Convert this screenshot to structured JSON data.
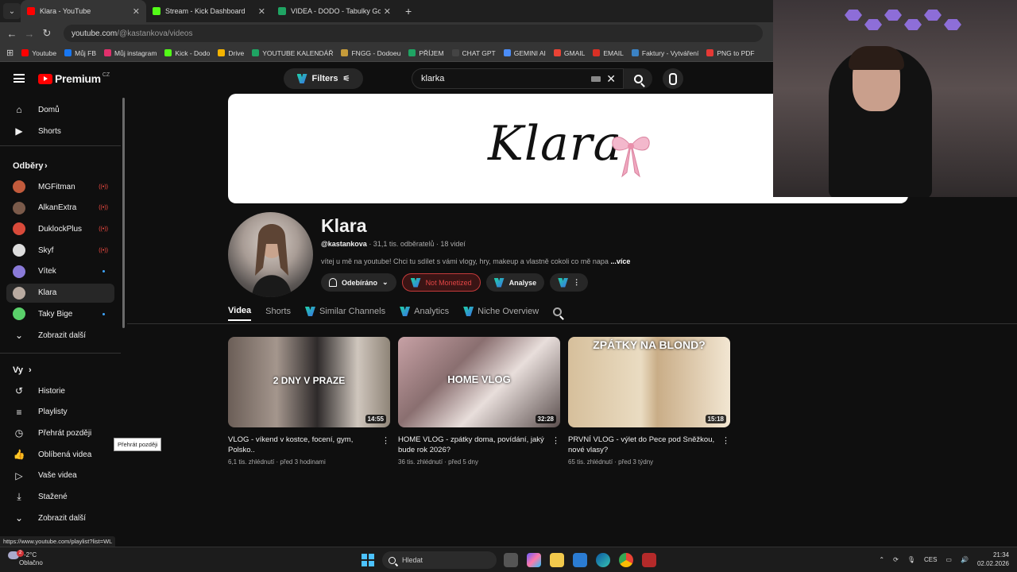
{
  "browser": {
    "tabs": [
      {
        "label": "Klara - YouTube",
        "color": "#ff0000",
        "active": true
      },
      {
        "label": "Stream - Kick Dashboard",
        "color": "#53fc18",
        "active": false
      },
      {
        "label": "VIDEA - DODO - Tabulky Goog",
        "color": "#1fa463",
        "active": false
      }
    ],
    "url_host": "youtube.com",
    "url_path": "/@kastankova/videos",
    "bookmarks": [
      {
        "label": "Youtube",
        "color": "#ff0000"
      },
      {
        "label": "Můj FB",
        "color": "#1877f2"
      },
      {
        "label": "Můj instagram",
        "color": "#e1306c"
      },
      {
        "label": "Kick - Dodo",
        "color": "#53fc18"
      },
      {
        "label": "Drive",
        "color": "#f4b400"
      },
      {
        "label": "YOUTUBE KALENDÁŘ",
        "color": "#1fa463"
      },
      {
        "label": "FNGG - Dodoeu",
        "color": "#c59b3a"
      },
      {
        "label": "PŘÍJEM",
        "color": "#1fa463"
      },
      {
        "label": "CHAT GPT",
        "color": "#444444"
      },
      {
        "label": "GEMINI AI",
        "color": "#4b8df8"
      },
      {
        "label": "GMAIL",
        "color": "#ea4335"
      },
      {
        "label": "EMAIL",
        "color": "#d93025"
      },
      {
        "label": "Faktury - Vytváření",
        "color": "#3b82c4"
      },
      {
        "label": "PNG to PDF",
        "color": "#e53935"
      }
    ]
  },
  "header": {
    "logo_text": "Premium",
    "logo_country": "CZ",
    "filters_label": "Filters",
    "search_value": "klarka"
  },
  "sidebar": {
    "main": [
      {
        "label": "Domů",
        "icon": "home-icon"
      },
      {
        "label": "Shorts",
        "icon": "shorts-icon"
      }
    ],
    "subs_heading": "Odběry",
    "subscriptions": [
      {
        "label": "MGFitman",
        "color": "#c25b3c",
        "live": true
      },
      {
        "label": "AlkanExtra",
        "color": "#7a5a4a",
        "live": true
      },
      {
        "label": "DuklockPlus",
        "color": "#d84a3a",
        "live": true
      },
      {
        "label": "Skyf",
        "color": "#dddddd",
        "live": true
      },
      {
        "label": "Vítek",
        "color": "#8a7ad8",
        "live": false,
        "dot": true
      },
      {
        "label": "Klara",
        "color": "#b8aaa0",
        "live": false,
        "selected": true
      },
      {
        "label": "Taky Bige",
        "color": "#5ad06a",
        "live": false,
        "dot": true
      }
    ],
    "show_more_1": "Zobrazit další",
    "you_heading": "Vy",
    "you_items": [
      {
        "label": "Historie",
        "icon": "history-icon"
      },
      {
        "label": "Playlisty",
        "icon": "playlists-icon"
      },
      {
        "label": "Přehrát později",
        "icon": "watch-later-icon"
      },
      {
        "label": "Oblíbená videa",
        "icon": "liked-icon"
      },
      {
        "label": "Vaše videa",
        "icon": "your-videos-icon"
      },
      {
        "label": "Stažené",
        "icon": "download-icon"
      }
    ],
    "show_more_2": "Zobrazit další",
    "tooltip": "Přehrát později"
  },
  "banner": {
    "text": "Klara"
  },
  "channel": {
    "name": "Klara",
    "handle": "@kastankova",
    "stats": " · 31,1 tis. odběratelů · 18 videí",
    "description": "vítej u mě na youtube! Chci tu sdílet s vámi vlogy, hry, makeup a vlastně cokoli co mě napa",
    "more": "...více",
    "subscribed_label": "Odebíráno",
    "monetization_label": "Not Monetized",
    "analyse_label": "Analyse"
  },
  "tabs": [
    {
      "label": "Videa",
      "active": true,
      "ext": false
    },
    {
      "label": "Shorts",
      "active": false,
      "ext": false
    },
    {
      "label": "Similar Channels",
      "active": false,
      "ext": true
    },
    {
      "label": "Analytics",
      "active": false,
      "ext": true
    },
    {
      "label": "Niche Overview",
      "active": false,
      "ext": true
    }
  ],
  "videos": [
    {
      "title": "VLOG - víkend v kostce, focení, gym, Polsko..",
      "meta": "6,1 tis. zhlédnutí · před 3 hodinami",
      "duration": "14:55",
      "thumb_text": "2 DNY V PRAZE"
    },
    {
      "title": "HOME VLOG - zpátky doma, povídání, jaký bude rok 2026?",
      "meta": "36 tis. zhlédnutí · před 5 dny",
      "duration": "32:28",
      "thumb_text": "HOME VLOG"
    },
    {
      "title": "PRVNÍ VLOG - výlet do Pece pod Sněžkou, nové vlasy?",
      "meta": "65 tis. zhlédnutí · před 3 týdny",
      "duration": "15:18",
      "thumb_text": "ZPÁTKY NA BLOND?"
    }
  ],
  "status_url": "https://www.youtube.com/playlist?list=WL",
  "taskbar": {
    "weather_temp": "-2°C",
    "weather_desc": "Oblačno",
    "notif_count": "2",
    "search_label": "Hledat",
    "lang": "CES",
    "time": "21:34",
    "date": "02.02.2026"
  }
}
